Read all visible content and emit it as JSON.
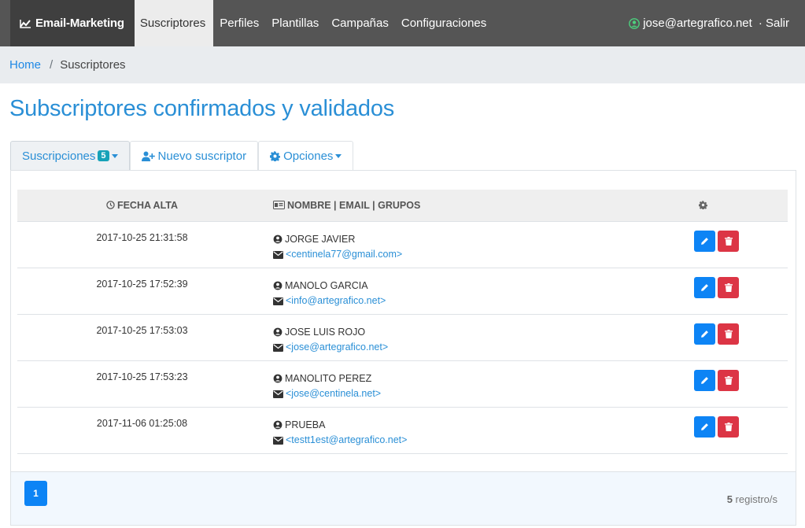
{
  "nav": {
    "brand": "Email-Marketing",
    "items": [
      "Suscriptores",
      "Perfiles",
      "Plantillas",
      "Campañas",
      "Configuraciones"
    ],
    "user": "jose@artegrafico.net",
    "logout": "· Salir"
  },
  "breadcrumb": {
    "home": "Home",
    "separator": "/",
    "current": "Suscriptores"
  },
  "page_title": "Subscriptores confirmados y validados",
  "tabs": {
    "subscriptions": "Suscripciones",
    "subscriptions_count": "5",
    "new_subscriber": "Nuevo suscriptor",
    "options": "Opciones"
  },
  "table": {
    "headers": {
      "date": "FECHA ALTA",
      "name": "NOMBRE | EMAIL | GRUPOS"
    },
    "rows": [
      {
        "date": "2017-10-25 21:31:58",
        "name": "JORGE JAVIER",
        "email": "<centinela77@gmail.com>"
      },
      {
        "date": "2017-10-25 17:52:39",
        "name": "MANOLO GARCIA",
        "email": "<info@artegrafico.net>"
      },
      {
        "date": "2017-10-25 17:53:03",
        "name": "JOSE LUIS ROJO",
        "email": "<jose@artegrafico.net>"
      },
      {
        "date": "2017-10-25 17:53:23",
        "name": "MANOLITO PEREZ",
        "email": "<jose@centinela.net>"
      },
      {
        "date": "2017-11-06 01:25:08",
        "name": "PRUEBA",
        "email": "<testt1est@artegrafico.net>"
      }
    ]
  },
  "footer": {
    "page": "1",
    "count": "5",
    "count_label": " registro/s"
  },
  "colors": {
    "accent": "#2a8fd6",
    "primary": "#0d84f5",
    "danger": "#dc3545",
    "navbar": "#555555"
  }
}
